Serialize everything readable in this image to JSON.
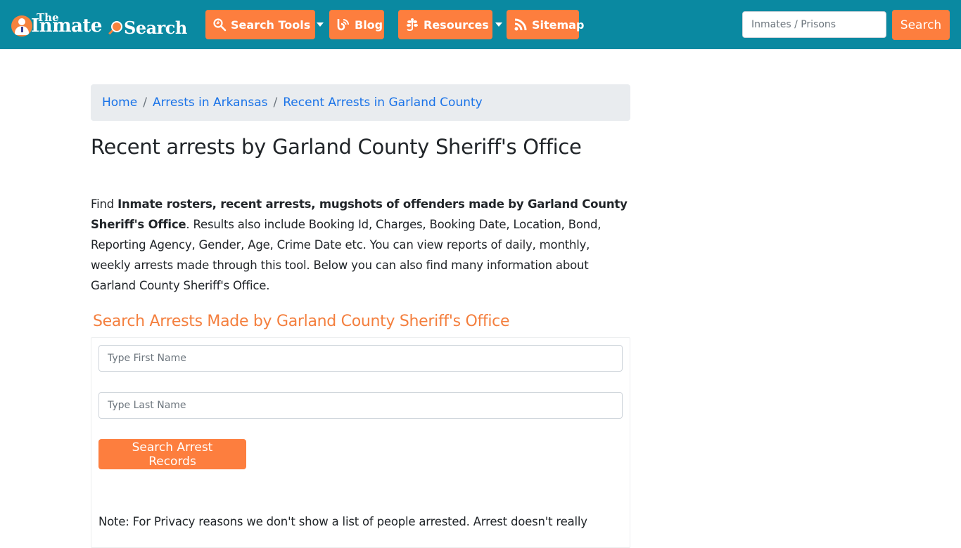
{
  "header": {
    "logo": {
      "top_word": "The",
      "word1": "Inmate",
      "word2": "Search"
    },
    "nav": [
      {
        "id": "search-tools",
        "label": "Search Tools",
        "icon": "search-icon",
        "has_dropdown": true
      },
      {
        "id": "blog",
        "label": "Blog",
        "icon": "blog-icon",
        "has_dropdown": false
      },
      {
        "id": "resources",
        "label": "Resources",
        "icon": "leaf-icon",
        "has_dropdown": true
      },
      {
        "id": "sitemap",
        "label": "Sitemap",
        "icon": "rss-icon",
        "has_dropdown": false
      }
    ],
    "search": {
      "placeholder": "Inmates / Prisons",
      "value": "",
      "button_label": "Search"
    }
  },
  "breadcrumb": [
    {
      "label": "Home"
    },
    {
      "label": "Arrests in Arkansas"
    },
    {
      "label": "Recent Arrests in Garland County"
    }
  ],
  "breadcrumb_separator": "/",
  "page_title": "Recent arrests by Garland County Sheriff's Office",
  "intro": {
    "prefix": "Find ",
    "bold": "Inmate rosters, recent arrests, mugshots of offenders made by Garland County Sheriff's Office",
    "suffix": ". Results also include Booking Id, Charges, Booking Date, Location, Bond, Reporting Agency, Gender, Age, Crime Date etc. You can view reports of daily, monthly, weekly arrests made through this tool. Below you can also find many information about Garland County Sheriff's Office."
  },
  "search_form": {
    "heading": "Search Arrests Made by Garland County Sheriff's Office",
    "first_name_placeholder": "Type First Name",
    "first_name_value": "",
    "last_name_placeholder": "Type Last Name",
    "last_name_value": "",
    "submit_label": "Search Arrest Records"
  },
  "note": "Note: For Privacy reasons we don't show a list of people arrested. Arrest doesn't really",
  "colors": {
    "navbar_bg": "#0a89a1",
    "accent_orange": "#fd7e3e",
    "heading_orange": "#f47f3e",
    "link_blue": "#1a73e8",
    "breadcrumb_bg": "#e9ecef"
  }
}
